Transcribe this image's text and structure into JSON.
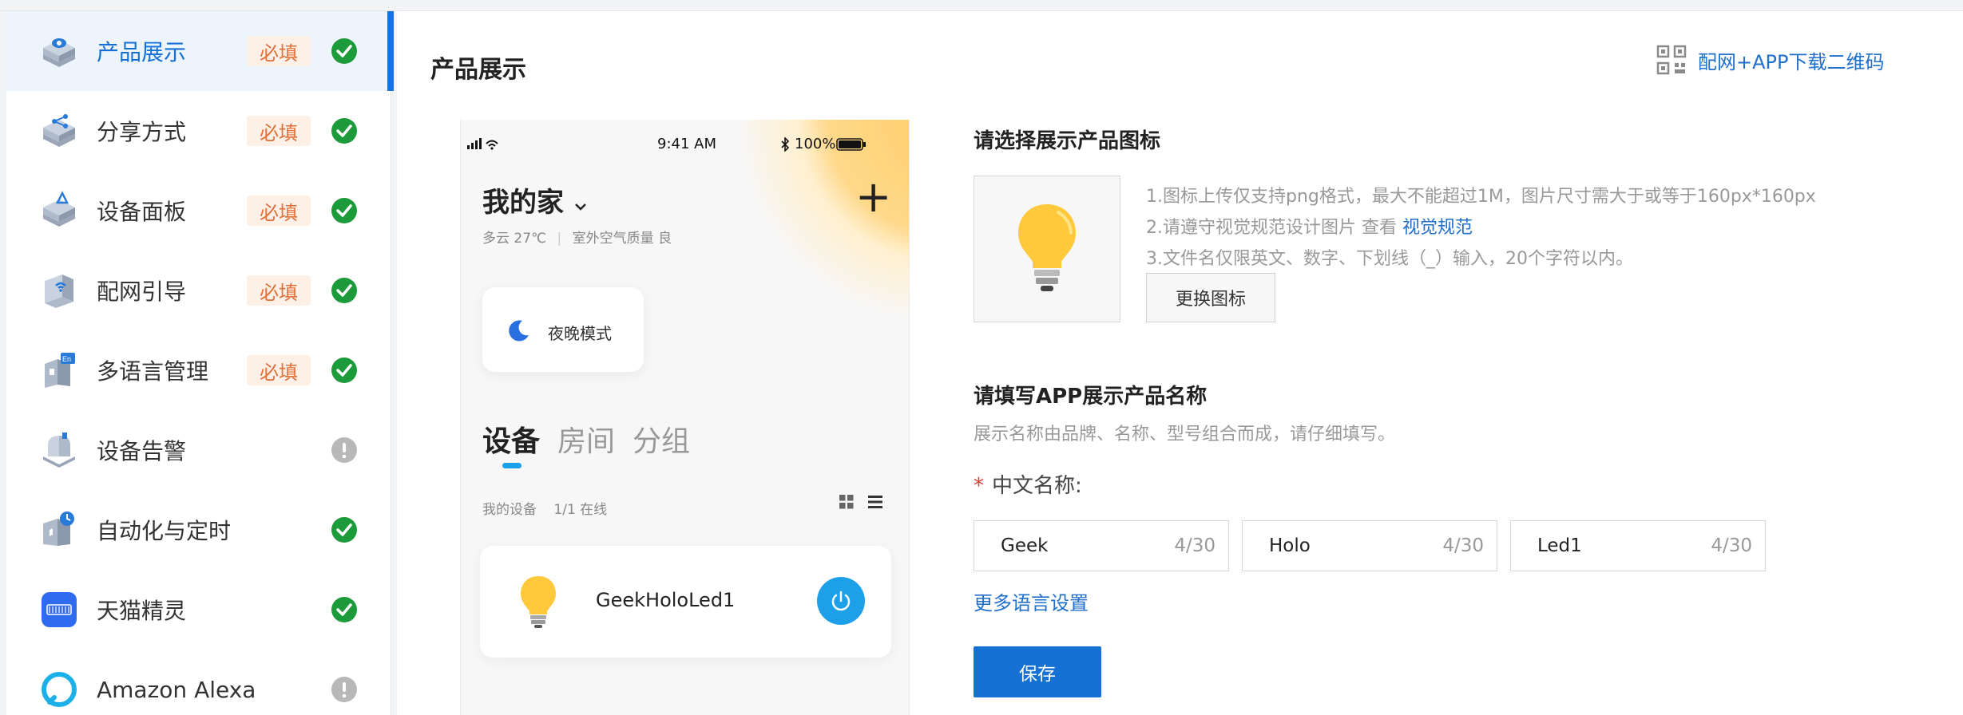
{
  "sidebar": {
    "items": [
      {
        "label": "产品展示",
        "badge": "必填",
        "status": "complete",
        "icon": "product-display-icon"
      },
      {
        "label": "分享方式",
        "badge": "必填",
        "status": "complete",
        "icon": "share-icon"
      },
      {
        "label": "设备面板",
        "badge": "必填",
        "status": "complete",
        "icon": "device-panel-icon"
      },
      {
        "label": "配网引导",
        "badge": "必填",
        "status": "complete",
        "icon": "network-guide-icon"
      },
      {
        "label": "多语言管理",
        "badge": "必填",
        "status": "complete",
        "icon": "language-icon"
      },
      {
        "label": "设备告警",
        "badge": "",
        "status": "warning",
        "icon": "device-alarm-icon"
      },
      {
        "label": "自动化与定时",
        "badge": "",
        "status": "complete",
        "icon": "automation-icon"
      },
      {
        "label": "天猫精灵",
        "badge": "",
        "status": "complete",
        "icon": "tmall-genie-icon"
      },
      {
        "label": "Amazon Alexa",
        "badge": "",
        "status": "warning",
        "icon": "alexa-icon"
      }
    ]
  },
  "main": {
    "title": "产品展示",
    "qr_link": "配网+APP下载二维码"
  },
  "phone": {
    "time": "9:41 AM",
    "battery": "100%",
    "home_title": "我的家",
    "weather": "多云 27℃",
    "air": "室外空气质量 良",
    "night_mode": "夜晚模式",
    "tabs": [
      "设备",
      "房间",
      "分组"
    ],
    "my_devices": "我的设备",
    "online": "1/1 在线",
    "device_name": "GeekHoloLed1"
  },
  "icon_section": {
    "title": "请选择展示产品图标",
    "help1": "1.图标上传仅支持png格式，最大不能超过1M，图片尺寸需大于或等于160px*160px",
    "help2_prefix": "2.请遵守视觉规范设计图片 查看 ",
    "help2_link": "视觉规范",
    "help3": "3.文件名仅限英文、数字、下划线（_）输入，20个字符以内。",
    "change_button": "更换图标"
  },
  "name_section": {
    "title": "请填写APP展示产品名称",
    "desc": "展示名称由品牌、名称、型号组合而成，请仔细填写。",
    "label": "中文名称:",
    "fields": [
      {
        "value": "Geek",
        "count": "4/30"
      },
      {
        "value": "Holo",
        "count": "4/30"
      },
      {
        "value": "Led1",
        "count": "4/30"
      }
    ],
    "more_link": "更多语言设置",
    "save": "保存"
  },
  "colors": {
    "accent": "#1470d3",
    "success": "#1d9a3a",
    "warning_gray": "#b8b8b8",
    "badge_text": "#e0703a"
  }
}
